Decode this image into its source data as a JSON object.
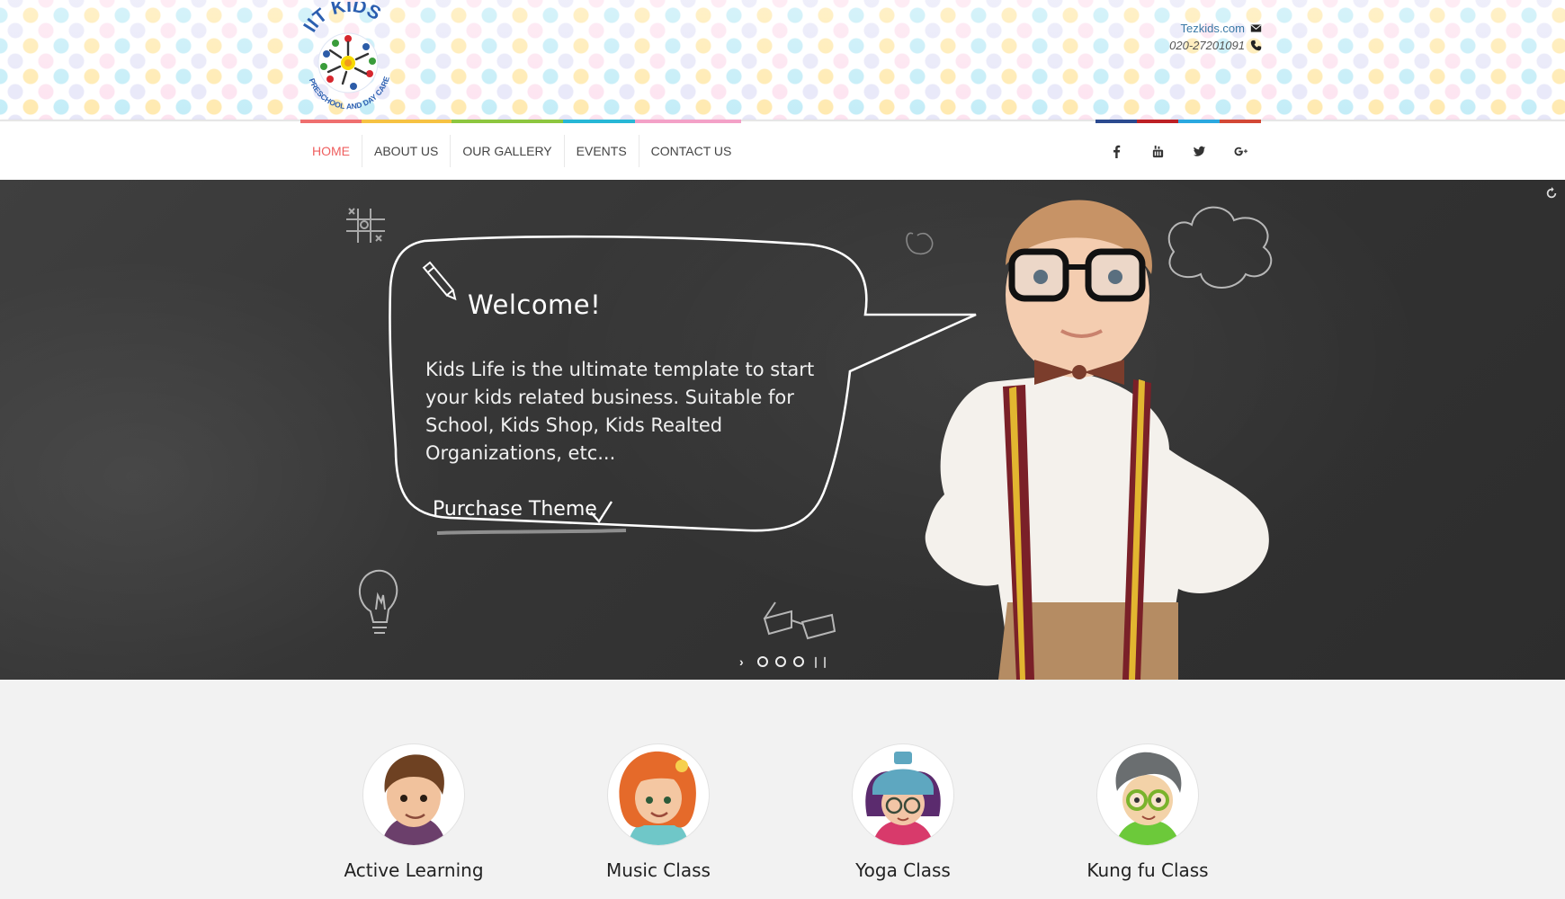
{
  "header": {
    "logo_text": "IIT KIDS",
    "logo_subtext": "PRESCHOOL AND DAY CARE",
    "website": "Tezkids.com",
    "phone": "020-27201091",
    "strip_colors": [
      "#ef6f6f",
      "#f6c243",
      "#8dc63f",
      "#27b7d6",
      "#f3a1c7"
    ]
  },
  "nav": {
    "items": [
      {
        "label": "HOME",
        "active": true
      },
      {
        "label": "ABOUT US"
      },
      {
        "label": "OUR GALLERY"
      },
      {
        "label": "EVENTS"
      },
      {
        "label": "CONTACT US"
      }
    ],
    "social": [
      {
        "icon": "facebook-icon",
        "color": "#2b4a8f"
      },
      {
        "icon": "youtube-icon",
        "color": "#bd2025"
      },
      {
        "icon": "twitter-icon",
        "color": "#2aa8e0"
      },
      {
        "icon": "google-plus-icon",
        "color": "#d34836"
      }
    ]
  },
  "hero": {
    "bubble_title": "Welcome!",
    "bubble_text": "Kids Life is the ultimate template to start your kids related business. Suitable for School, Kids Shop, Kids Realted Organizations, etc...",
    "cta": "Purchase Theme",
    "slider": {
      "dots": 3,
      "current": 0
    }
  },
  "features": [
    {
      "title": "Active Learning",
      "avatar": "boy-avatar"
    },
    {
      "title": "Music Class",
      "avatar": "redhead-girl-avatar"
    },
    {
      "title": "Yoga Class",
      "avatar": "hat-girl-avatar"
    },
    {
      "title": "Kung fu Class",
      "avatar": "glasses-boy-avatar"
    }
  ]
}
